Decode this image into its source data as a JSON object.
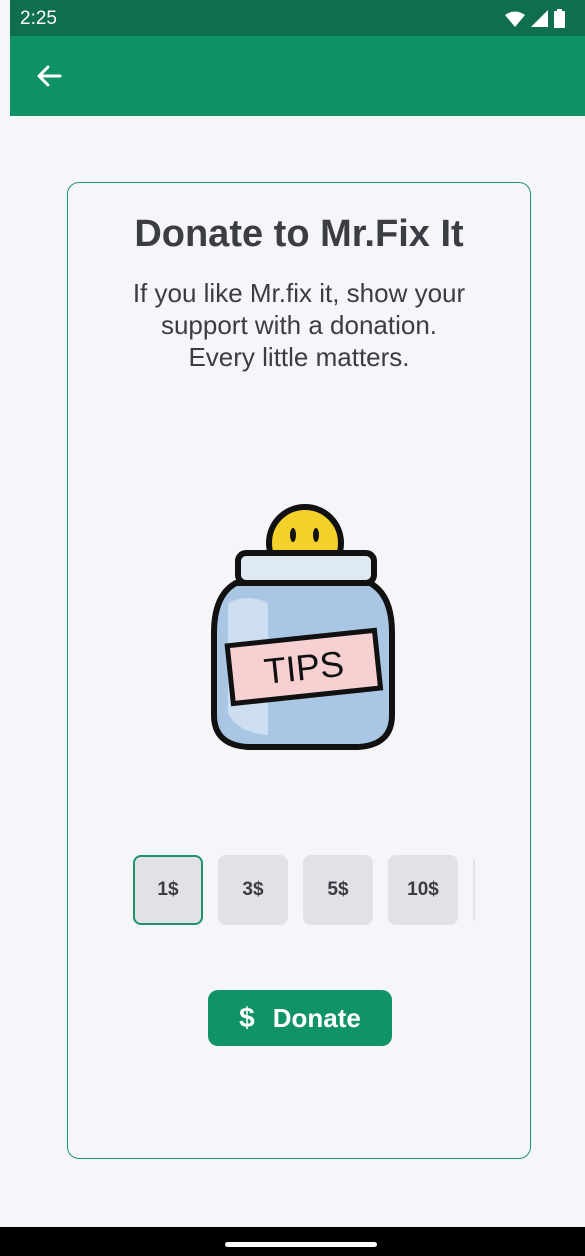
{
  "status_bar": {
    "time": "2:25",
    "icons": [
      "wifi-icon",
      "signal-icon",
      "battery-icon"
    ]
  },
  "app_bar": {
    "back_icon": "arrow-left-icon"
  },
  "card": {
    "title": "Donate to Mr.Fix It",
    "subtitle": "If you like Mr.fix it, show your\nsupport with a donation.\nEvery little matters.",
    "illustration": {
      "jar_label": "TIPS"
    }
  },
  "amounts": {
    "options": [
      "1$",
      "3$",
      "5$",
      "10$"
    ],
    "selected": "1$"
  },
  "donate_button": {
    "icon": "$",
    "label": "Donate"
  },
  "colors": {
    "status_bar": "#0f6f4d",
    "app_bar": "#0f9266",
    "accent": "#109466",
    "background": "#f6f6fa",
    "text": "#3b3d44"
  }
}
